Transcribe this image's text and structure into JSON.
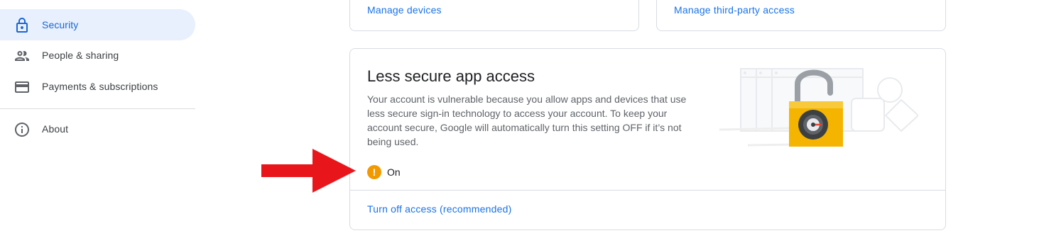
{
  "sidebar": {
    "items": [
      {
        "label": "Security",
        "icon": "lock-icon"
      },
      {
        "label": "People & sharing",
        "icon": "people-icon"
      },
      {
        "label": "Payments & subscriptions",
        "icon": "credit-card-icon"
      },
      {
        "label": "About",
        "icon": "info-icon"
      }
    ]
  },
  "top_cards": {
    "left_link": "Manage devices",
    "right_link": "Manage third-party access"
  },
  "less_secure": {
    "title": "Less secure app access",
    "description": "Your account is vulnerable because you allow apps and devices that use less secure sign-in technology to access your account. To keep your account secure, Google will automatically turn this setting OFF if it’s not being used.",
    "status_icon": "warning-icon",
    "status": "On",
    "action": "Turn off access (recommended)"
  },
  "colors": {
    "accent": "#1a73e8",
    "active_bg": "#e8f0fe",
    "warning": "#f29900",
    "annotation_arrow": "#e8161b",
    "lock": "#f4b400"
  }
}
